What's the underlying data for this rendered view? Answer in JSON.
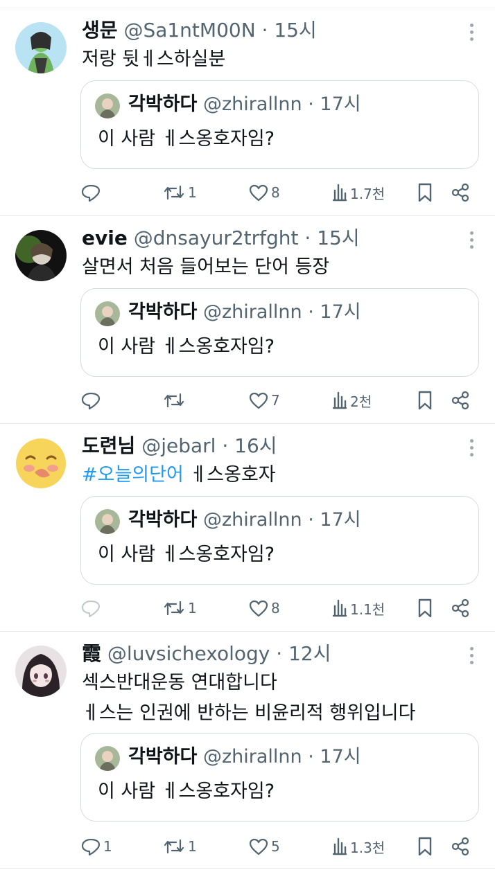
{
  "tweets": [
    {
      "name": "생문",
      "handle": "@Sa1ntM00N",
      "time": "15시",
      "lines": [
        "저랑 뒷ㅔ스하실분"
      ],
      "hashtag": "",
      "quote": {
        "name": "각박하다",
        "handle": "@zhirallnn",
        "time": "17시",
        "text": "이 사람 ㅔ스옹호자임?"
      },
      "replies": "",
      "retweets": "1",
      "likes": "8",
      "views": "1.7천",
      "avatar_colors": [
        "#7ac36a",
        "#2f2f2f"
      ]
    },
    {
      "name": "evie",
      "handle": "@dnsayur2trfght",
      "time": "15시",
      "lines": [
        "살면서 처음 들어보는 단어 등장"
      ],
      "hashtag": "",
      "quote": {
        "name": "각박하다",
        "handle": "@zhirallnn",
        "time": "17시",
        "text": "이 사람 ㅔ스옹호자임?"
      },
      "replies": "",
      "retweets": "",
      "likes": "7",
      "views": "2천",
      "avatar_colors": [
        "#3c5a28",
        "#111111"
      ]
    },
    {
      "name": "도련님",
      "handle": "@jebarl",
      "time": "16시",
      "lines": [
        "ㅔ스옹호자"
      ],
      "hashtag": "#오늘의단어",
      "quote": {
        "name": "각박하다",
        "handle": "@zhirallnn",
        "time": "17시",
        "text": "이 사람 ㅔ스옹호자임?"
      },
      "replies": "",
      "retweets": "1",
      "likes": "8",
      "views": "1.1천",
      "avatar_colors": [
        "#f7d45a",
        "#e88a6a"
      ]
    },
    {
      "name": "霞",
      "handle": "@luvsichexology",
      "time": "12시",
      "lines": [
        "섹스반대운동 연대합니다",
        "ㅔ스는 인권에 반하는 비윤리적 행위입니다"
      ],
      "hashtag": "",
      "quote": {
        "name": "각박하다",
        "handle": "@zhirallnn",
        "time": "17시",
        "text": "이 사람 ㅔ스옹호자임?"
      },
      "replies": "1",
      "retweets": "1",
      "likes": "5",
      "views": "1.3천",
      "avatar_colors": [
        "#2a2226",
        "#c9a0a8"
      ]
    }
  ],
  "icons": {
    "reply": "reply-icon",
    "retweet": "retweet-icon",
    "like": "heart-icon",
    "views": "views-icon",
    "bookmark": "bookmark-icon",
    "share": "share-icon",
    "more": "more-icon"
  },
  "colors": {
    "text": "#0f1419",
    "secondary": "#536471",
    "hashtag": "#1d9bf0",
    "border": "#d6dbdf"
  }
}
